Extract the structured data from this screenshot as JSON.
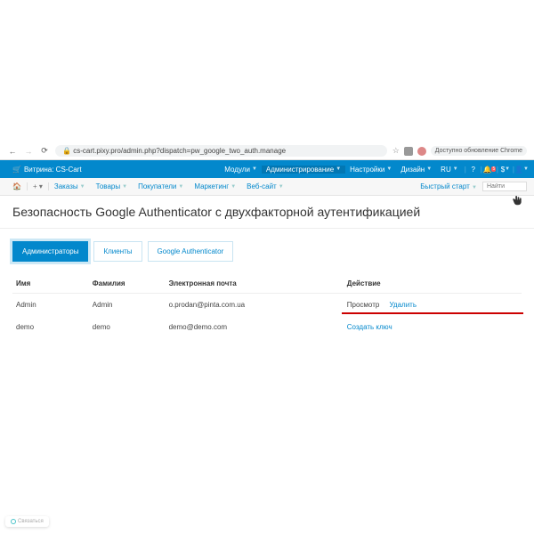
{
  "browser": {
    "url": "cs-cart.pixy.pro/admin.php?dispatch=pw_google_two_auth.manage",
    "update": "Доступно обновление Chrome"
  },
  "topbar": {
    "brand": "Витрина: CS-Cart",
    "menu": {
      "addons": "Модули",
      "admin": "Администрирование",
      "settings": "Настройки",
      "design": "Дизайн",
      "lang": "RU"
    }
  },
  "subbar": {
    "orders": "Заказы",
    "products": "Товары",
    "customers": "Покупатели",
    "marketing": "Маркетинг",
    "website": "Веб-сайт",
    "quickstart": "Быстрый старт",
    "search_placeholder": "Найти"
  },
  "page": {
    "title": "Безопасность Google Authenticator с двухфакторной аутентификацией"
  },
  "tabs": {
    "admins": "Администраторы",
    "clients": "Клиенты",
    "gauth": "Google Authenticator"
  },
  "table": {
    "headers": {
      "name": "Имя",
      "surname": "Фамилия",
      "email": "Электронная почта",
      "action": "Действие"
    },
    "rows": [
      {
        "name": "Admin",
        "surname": "Admin",
        "email": "o.prodan@pinta.com.ua",
        "action1": "Просмотр",
        "action2": "Удалить"
      },
      {
        "name": "demo",
        "surname": "demo",
        "email": "demo@demo.com",
        "action_create": "Создать ключ"
      }
    ]
  },
  "ticket": "Связаться"
}
